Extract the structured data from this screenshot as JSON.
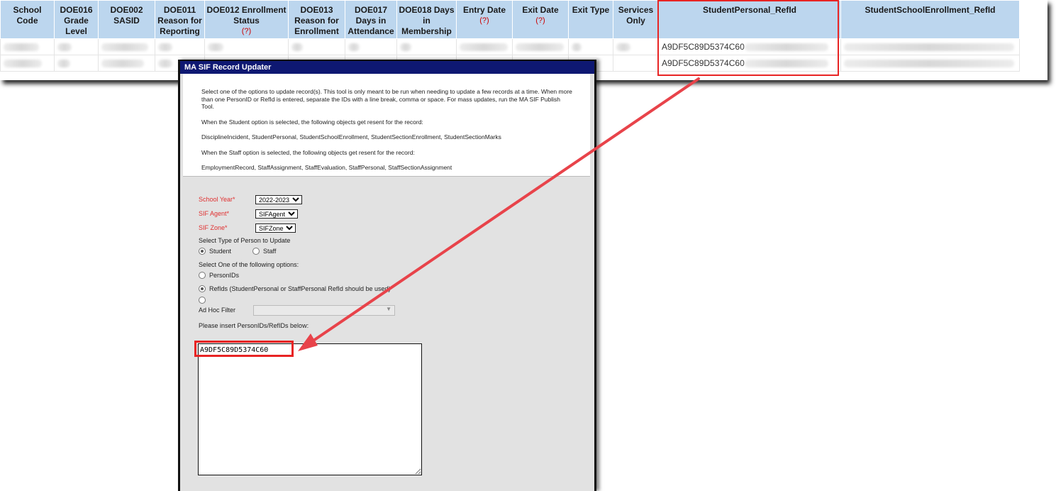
{
  "report": {
    "columns": [
      {
        "label": "School Code",
        "required": false
      },
      {
        "label": "DOE016 Grade Level",
        "required": false
      },
      {
        "label": "DOE002 SASID",
        "required": false
      },
      {
        "label": "DOE011 Reason for Reporting",
        "required": false
      },
      {
        "label": "DOE012 Enrollment Status",
        "required": true
      },
      {
        "label": "DOE013 Reason for Enrollment",
        "required": false
      },
      {
        "label": "DOE017 Days in Attendance",
        "required": false
      },
      {
        "label": "DOE018 Days in Membership",
        "required": false
      },
      {
        "label": "Entry Date",
        "required": true
      },
      {
        "label": "Exit Date",
        "required": true
      },
      {
        "label": "Exit Type",
        "required": false
      },
      {
        "label": "Services Only",
        "required": false
      },
      {
        "label": "StudentPersonal_RefId",
        "required": false
      },
      {
        "label": "StudentSchoolEnrollment_RefId",
        "required": false
      }
    ],
    "required_marker": "(?)",
    "rows": [
      {
        "student_personal_refid": "A9DF5C89D5374C60"
      },
      {
        "student_personal_refid": "A9DF5C89D5374C60"
      }
    ]
  },
  "modal": {
    "title": "MA SIF Record Updater",
    "info": [
      "Select one of the options to update record(s). This tool is only meant to be run when needing to update a few records at a time. When more than one PersonID or RefId is entered, separate the IDs with a line break, comma or space. For mass updates, run the MA SIF Publish Tool.",
      "When the Student option is selected, the following objects get resent for the record:",
      "DisciplineIncident, StudentPersonal, StudentSchoolEnrollment, StudentSectionEnrollment, StudentSectionMarks",
      "When the Staff option is selected, the following objects get resent for the record:",
      "EmploymentRecord, StaffAssignment, StaffEvaluation, StaffPersonal, StaffSectionAssignment"
    ],
    "school_year": {
      "label": "School Year*",
      "value": "2022-2023"
    },
    "sif_agent": {
      "label": "SIF Agent*",
      "value": "SIFAgent"
    },
    "sif_zone": {
      "label": "SIF Zone*",
      "value": "SIFZone"
    },
    "person_type": {
      "label": "Select Type of Person to Update",
      "student": "Student",
      "staff": "Staff",
      "selected": "Student"
    },
    "options": {
      "label": "Select One of the following options:",
      "person_ids": "PersonIDs",
      "refids": "RefIds (StudentPersonal or StaffPersonal RefId should be used)",
      "adhoc": "Ad Hoc Filter",
      "selected": "RefIds"
    },
    "ids_input": {
      "label": "Please insert PersonIDs/RefIDs below:",
      "value": "A9DF5C89D5374C60"
    }
  },
  "colors": {
    "header_bg": "#bcd6ee",
    "modal_title_bg": "#0e1872",
    "highlight": "#e82424",
    "required": "#e03030"
  }
}
